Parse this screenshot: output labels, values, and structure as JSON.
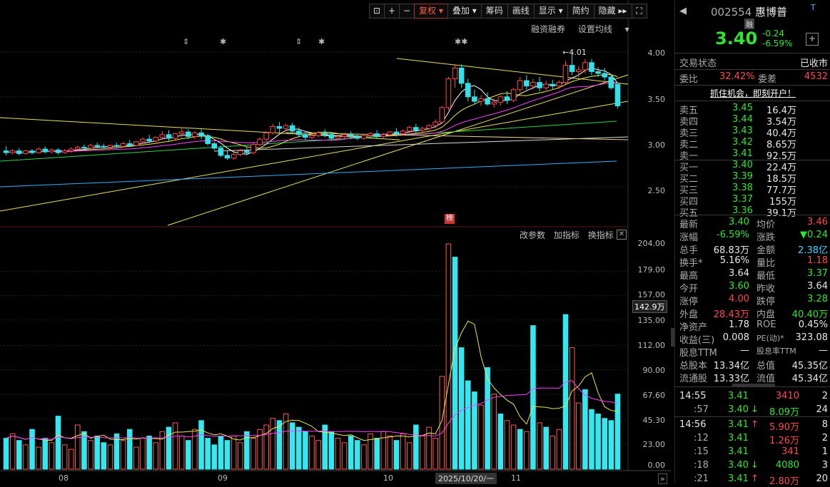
{
  "toolbar": {
    "items": [
      "复权",
      "叠加",
      "筹码",
      "画线",
      "显示",
      "简约",
      "隐藏"
    ],
    "active": "复权"
  },
  "sublinks": [
    "融资融券",
    "设置均线"
  ],
  "vol_links": [
    "改参数",
    "加指标",
    "换指标"
  ],
  "badge": "榜",
  "high_label": "4.01",
  "price_axis": [
    "4.00",
    "3.50",
    "3.00",
    "2.50"
  ],
  "vol_axis": [
    "204.00",
    "179.00",
    "157.00",
    "135.00",
    "112.00",
    "90.00",
    "67.60",
    "45.30",
    "23.00",
    "0.00"
  ],
  "vol_current": "142.9万",
  "x_axis": [
    "08",
    "09",
    "10",
    "11"
  ],
  "x_selected": "2025/10/20/一",
  "chart_data": {
    "type": "candlestick",
    "x_ticks": [
      "08",
      "09",
      "10",
      "11"
    ],
    "price_ylim": [
      2.2,
      4.1
    ],
    "volume_ylim": [
      0,
      204
    ],
    "candles": [
      [
        2.9,
        2.95,
        2.88,
        2.85
      ],
      [
        2.88,
        2.92,
        2.9,
        2.86
      ],
      [
        2.9,
        2.93,
        2.87,
        2.85
      ],
      [
        2.87,
        2.91,
        2.9,
        2.86
      ],
      [
        2.9,
        2.92,
        2.88,
        2.86
      ],
      [
        2.88,
        2.94,
        2.92,
        2.87
      ],
      [
        2.92,
        2.95,
        2.89,
        2.87
      ],
      [
        2.89,
        2.93,
        2.91,
        2.87
      ],
      [
        2.91,
        2.93,
        2.88,
        2.86
      ],
      [
        2.88,
        2.92,
        2.9,
        2.87
      ],
      [
        2.9,
        2.94,
        2.92,
        2.88
      ],
      [
        2.92,
        2.96,
        2.94,
        2.9
      ],
      [
        2.94,
        2.97,
        2.93,
        2.91
      ],
      [
        2.93,
        2.98,
        2.96,
        2.92
      ],
      [
        2.96,
        2.99,
        2.95,
        2.93
      ],
      [
        2.95,
        2.98,
        2.94,
        2.92
      ],
      [
        2.94,
        2.97,
        2.96,
        2.92
      ],
      [
        2.96,
        2.99,
        2.95,
        2.93
      ],
      [
        2.95,
        3.0,
        2.98,
        2.94
      ],
      [
        2.98,
        3.02,
        2.96,
        2.94
      ],
      [
        2.96,
        3.01,
        3.0,
        2.95
      ],
      [
        3.0,
        3.05,
        3.03,
        2.98
      ],
      [
        3.03,
        3.08,
        3.01,
        2.99
      ],
      [
        3.01,
        3.06,
        3.05,
        2.99
      ],
      [
        3.05,
        3.12,
        3.08,
        3.02
      ],
      [
        3.08,
        3.13,
        3.04,
        3.01
      ],
      [
        3.04,
        3.1,
        3.09,
        3.02
      ],
      [
        3.09,
        3.15,
        3.11,
        3.05
      ],
      [
        3.11,
        3.14,
        3.06,
        3.03
      ],
      [
        3.06,
        3.12,
        3.1,
        3.03
      ],
      [
        3.1,
        3.14,
        3.07,
        3.03
      ],
      [
        3.07,
        3.09,
        2.98,
        2.96
      ],
      [
        2.98,
        3.0,
        2.93,
        2.91
      ],
      [
        2.93,
        2.96,
        2.85,
        2.83
      ],
      [
        2.85,
        2.9,
        2.82,
        2.8
      ],
      [
        2.82,
        2.88,
        2.86,
        2.8
      ],
      [
        2.86,
        2.92,
        2.9,
        2.84
      ],
      [
        2.9,
        2.95,
        2.88,
        2.85
      ],
      [
        2.88,
        3.0,
        2.97,
        2.86
      ],
      [
        2.97,
        3.05,
        3.03,
        2.95
      ],
      [
        3.03,
        3.12,
        3.1,
        3.0
      ],
      [
        3.1,
        3.2,
        3.17,
        3.08
      ],
      [
        3.17,
        3.22,
        3.15,
        3.1
      ],
      [
        3.15,
        3.2,
        3.18,
        3.12
      ],
      [
        3.18,
        3.21,
        3.12,
        3.1
      ],
      [
        3.12,
        3.16,
        3.08,
        3.05
      ],
      [
        3.08,
        3.12,
        3.05,
        3.02
      ],
      [
        3.05,
        3.1,
        3.07,
        3.03
      ],
      [
        3.07,
        3.12,
        3.1,
        3.05
      ],
      [
        3.1,
        3.14,
        3.08,
        3.05
      ],
      [
        3.08,
        3.11,
        3.04,
        3.02
      ],
      [
        3.04,
        3.08,
        3.06,
        3.02
      ],
      [
        3.06,
        3.1,
        3.08,
        3.04
      ],
      [
        3.08,
        3.12,
        3.06,
        3.03
      ],
      [
        3.06,
        3.09,
        3.04,
        3.02
      ],
      [
        3.04,
        3.08,
        3.07,
        3.02
      ],
      [
        3.07,
        3.11,
        3.09,
        3.05
      ],
      [
        3.09,
        3.13,
        3.06,
        3.04
      ],
      [
        3.06,
        3.1,
        3.08,
        3.04
      ],
      [
        3.08,
        3.12,
        3.11,
        3.06
      ],
      [
        3.11,
        3.15,
        3.09,
        3.06
      ],
      [
        3.09,
        3.14,
        3.12,
        3.07
      ],
      [
        3.12,
        3.18,
        3.16,
        3.1
      ],
      [
        3.16,
        3.2,
        3.13,
        3.1
      ],
      [
        3.13,
        3.17,
        3.15,
        3.11
      ],
      [
        3.15,
        3.2,
        3.18,
        3.12
      ],
      [
        3.18,
        3.25,
        3.22,
        3.15
      ],
      [
        3.22,
        3.4,
        3.38,
        3.2
      ],
      [
        3.38,
        3.72,
        3.7,
        3.35
      ],
      [
        3.7,
        3.85,
        3.82,
        3.6
      ],
      [
        3.82,
        3.86,
        3.65,
        3.6
      ],
      [
        3.65,
        3.7,
        3.5,
        3.45
      ],
      [
        3.5,
        3.58,
        3.45,
        3.42
      ],
      [
        3.45,
        3.52,
        3.48,
        3.4
      ],
      [
        3.48,
        3.55,
        3.42,
        3.4
      ],
      [
        3.42,
        3.48,
        3.44,
        3.38
      ],
      [
        3.44,
        3.52,
        3.5,
        3.4
      ],
      [
        3.5,
        3.56,
        3.46,
        3.42
      ],
      [
        3.46,
        3.6,
        3.58,
        3.44
      ],
      [
        3.58,
        3.72,
        3.68,
        3.55
      ],
      [
        3.68,
        3.74,
        3.62,
        3.58
      ],
      [
        3.62,
        3.7,
        3.66,
        3.58
      ],
      [
        3.66,
        3.72,
        3.6,
        3.56
      ],
      [
        3.6,
        3.68,
        3.64,
        3.57
      ],
      [
        3.64,
        3.69,
        3.62,
        3.58
      ],
      [
        3.62,
        3.68,
        3.66,
        3.59
      ],
      [
        3.66,
        3.9,
        3.85,
        3.64
      ],
      [
        3.85,
        4.01,
        3.78,
        3.74
      ],
      [
        3.78,
        3.84,
        3.8,
        3.72
      ],
      [
        3.8,
        3.92,
        3.88,
        3.76
      ],
      [
        3.88,
        3.92,
        3.78,
        3.74
      ],
      [
        3.78,
        3.83,
        3.76,
        3.72
      ],
      [
        3.76,
        3.82,
        3.72,
        3.68
      ],
      [
        3.72,
        3.75,
        3.6,
        3.58
      ],
      [
        3.64,
        3.64,
        3.4,
        3.37
      ]
    ],
    "volumes": [
      28,
      32,
      26,
      22,
      36,
      20,
      28,
      24,
      48,
      22,
      18,
      40,
      34,
      26,
      30,
      24,
      22,
      32,
      26,
      36,
      20,
      28,
      30,
      24,
      34,
      38,
      42,
      30,
      26,
      36,
      44,
      28,
      22,
      30,
      26,
      30,
      24,
      34,
      28,
      36,
      40,
      46,
      44,
      50,
      42,
      38,
      34,
      30,
      26,
      40,
      34,
      28,
      24,
      30,
      26,
      22,
      32,
      28,
      34,
      30,
      26,
      32,
      24,
      40,
      30,
      38,
      28,
      84,
      204,
      192,
      110,
      80,
      70,
      58,
      92,
      68,
      50,
      44,
      40,
      36,
      34,
      130,
      42,
      38,
      30,
      36,
      140,
      110,
      60,
      72,
      54,
      50,
      46,
      44,
      68
    ],
    "volume_up": [
      false,
      true,
      false,
      true,
      false,
      true,
      false,
      true,
      false,
      true,
      true,
      true,
      false,
      true,
      false,
      false,
      true,
      false,
      true,
      false,
      true,
      true,
      false,
      true,
      true,
      false,
      true,
      true,
      false,
      true,
      false,
      false,
      false,
      false,
      false,
      true,
      true,
      false,
      true,
      true,
      true,
      true,
      false,
      true,
      false,
      false,
      false,
      true,
      true,
      false,
      false,
      true,
      true,
      false,
      false,
      true,
      true,
      false,
      true,
      true,
      false,
      true,
      true,
      false,
      true,
      true,
      true,
      true,
      true,
      false,
      false,
      false,
      false,
      true,
      false,
      true,
      false,
      true,
      true,
      false,
      true,
      false,
      true,
      false,
      true,
      true,
      false,
      true,
      true,
      false,
      false,
      false,
      false,
      false,
      false
    ]
  },
  "quote": {
    "code": "002554",
    "name": "惠博普",
    "tag": "融",
    "price": "3.40",
    "change": "-0.24",
    "change_pct": "-6.59%",
    "status_label": "交易状态",
    "status_value": "已收市",
    "webi_label": "委比",
    "webi_value": "32.42%",
    "weicha_label": "委差",
    "weicha_value": "4532",
    "banner": "抓住机会，即刻开户！",
    "asks": [
      {
        "label": "卖五",
        "price": "3.45",
        "vol": "16.4万"
      },
      {
        "label": "卖四",
        "price": "3.44",
        "vol": "3.54万"
      },
      {
        "label": "卖三",
        "price": "3.43",
        "vol": "40.4万"
      },
      {
        "label": "卖二",
        "price": "3.42",
        "vol": "8.65万"
      },
      {
        "label": "卖一",
        "price": "3.41",
        "vol": "92.5万"
      }
    ],
    "bids": [
      {
        "label": "买一",
        "price": "3.40",
        "vol": "22.4万"
      },
      {
        "label": "买二",
        "price": "3.39",
        "vol": "18.5万"
      },
      {
        "label": "买三",
        "price": "3.38",
        "vol": "77.7万"
      },
      {
        "label": "买四",
        "price": "3.37",
        "vol": "155万"
      },
      {
        "label": "买五",
        "price": "3.36",
        "vol": "39.1万"
      }
    ],
    "stats": [
      {
        "l1": "最新",
        "v1": "3.40",
        "c1": "green",
        "l2": "均价",
        "v2": "3.46",
        "c2": "red"
      },
      {
        "l1": "涨幅",
        "v1": "-6.59%",
        "c1": "green",
        "l2": "涨跌",
        "v2": "▼0.24",
        "c2": "green"
      },
      {
        "l1": "总手",
        "v1": "68.83万",
        "c1": "white",
        "l2": "金额",
        "v2": "2.38亿",
        "c2": "cyan"
      },
      {
        "l1": "换手*",
        "v1": "5.16%",
        "c1": "white",
        "l2": "量比",
        "v2": "1.18",
        "c2": "red"
      },
      {
        "l1": "最高",
        "v1": "3.64",
        "c1": "white",
        "l2": "最低",
        "v2": "3.37",
        "c2": "green"
      },
      {
        "l1": "今开",
        "v1": "3.60",
        "c1": "green",
        "l2": "昨收",
        "v2": "3.64",
        "c2": "white"
      },
      {
        "l1": "涨停",
        "v1": "4.00",
        "c1": "red",
        "l2": "跌停",
        "v2": "3.28",
        "c2": "green"
      },
      {
        "l1": "外盘",
        "v1": "28.43万",
        "c1": "red",
        "l2": "内盘",
        "v2": "40.40万",
        "c2": "green"
      },
      {
        "l1": "净资产",
        "v1": "1.78",
        "c1": "white",
        "l2": "ROE",
        "v2": "0.45%",
        "c2": "white"
      },
      {
        "l1": "收益(三)",
        "v1": "0.008",
        "c1": "white",
        "l2": "PE(动)*",
        "v2": "323.08",
        "c2": "white"
      },
      {
        "l1": "股息TTM",
        "v1": "—",
        "c1": "white",
        "l2": "股息率TTM",
        "v2": "—",
        "c2": "white"
      },
      {
        "l1": "总股本",
        "v1": "13.34亿",
        "c1": "white",
        "l2": "总值",
        "v2": "45.35亿",
        "c2": "white"
      },
      {
        "l1": "流通股",
        "v1": "13.33亿",
        "c1": "white",
        "l2": "流值",
        "v2": "45.34亿",
        "c2": "white"
      }
    ],
    "ticks": [
      {
        "time": "14:55",
        "price": "3.41",
        "pc": "green",
        "arrow": "",
        "vol": "3410",
        "vc": "red",
        "n": "2"
      },
      {
        "time": ":57",
        "price": "3.40",
        "pc": "green",
        "arrow": "↓",
        "vol": "8.09万",
        "vc": "green",
        "n": "24"
      },
      {
        "time": "14:56",
        "price": "3.41",
        "pc": "green",
        "arrow": "↑",
        "vol": "5.90万",
        "vc": "red",
        "n": "8"
      },
      {
        "time": ":12",
        "price": "3.41",
        "pc": "green",
        "arrow": "",
        "vol": "1.26万",
        "vc": "red",
        "n": "2"
      },
      {
        "time": ":15",
        "price": "3.41",
        "pc": "green",
        "arrow": "",
        "vol": "341",
        "vc": "red",
        "n": "1"
      },
      {
        "time": ":18",
        "price": "3.40",
        "pc": "green",
        "arrow": "↓",
        "vol": "4080",
        "vc": "green",
        "n": "3"
      },
      {
        "time": ":21",
        "price": "3.41",
        "pc": "green",
        "arrow": "↑",
        "vol": "2.80万",
        "vc": "red",
        "n": "20"
      }
    ]
  }
}
